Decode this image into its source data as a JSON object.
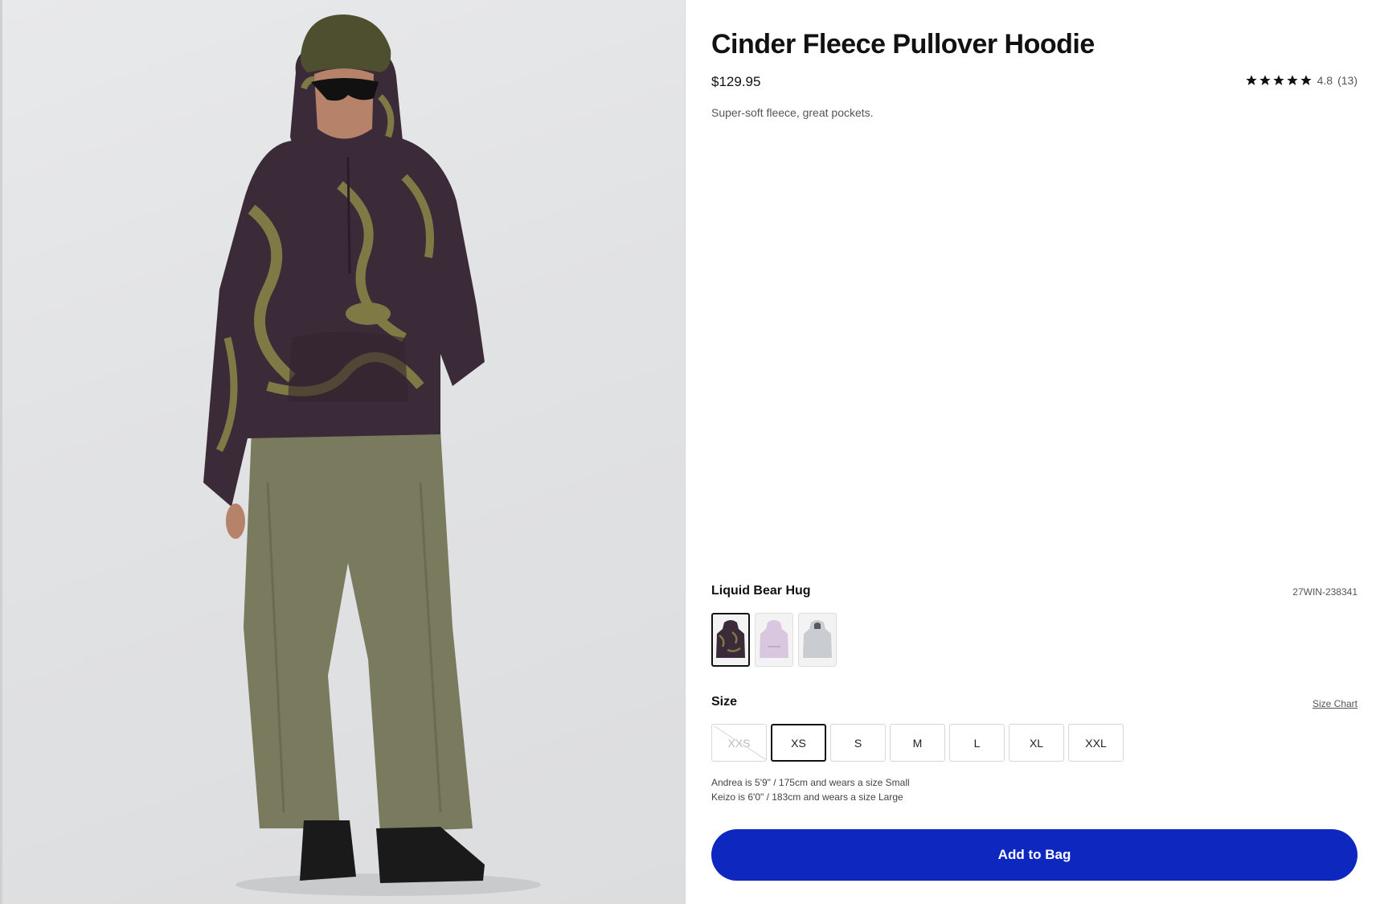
{
  "product": {
    "title": "Cinder Fleece Pullover Hoodie",
    "price": "$129.95",
    "rating": "4.8",
    "review_count": "(13)",
    "stars": 5,
    "description": "Super-soft fleece, great pockets."
  },
  "variant": {
    "color_name": "Liquid Bear Hug",
    "sku": "27WIN-238341",
    "swatches": [
      {
        "name": "liquid-bear-hug",
        "color": "#3b2a38",
        "accent": "#7f7a45",
        "selected": true
      },
      {
        "name": "lavender",
        "color": "#d9c7e0",
        "accent": "#cbb6d6",
        "selected": false
      },
      {
        "name": "gray",
        "color": "#c9ccd0",
        "accent": "#b8bcc2",
        "selected": false
      }
    ]
  },
  "size": {
    "label": "Size",
    "chart_link": "Size Chart",
    "options": [
      {
        "label": "XXS",
        "state": "unavailable"
      },
      {
        "label": "XS",
        "state": "selected"
      },
      {
        "label": "S",
        "state": "available"
      },
      {
        "label": "M",
        "state": "available"
      },
      {
        "label": "L",
        "state": "available"
      },
      {
        "label": "XL",
        "state": "available"
      },
      {
        "label": "XXL",
        "state": "available"
      }
    ]
  },
  "fit_notes": [
    "Andrea is 5'9\" / 175cm and wears a size Small",
    "Keizo is 6'0\" / 183cm and wears a size Large"
  ],
  "cta": {
    "add_to_bag": "Add to Bag"
  },
  "colors": {
    "accent": "#0e28bf",
    "hoodie": "#3b2a38",
    "pattern": "#7f7a45",
    "pants": "#7a7a5e",
    "beanie": "#4e4f2e"
  }
}
